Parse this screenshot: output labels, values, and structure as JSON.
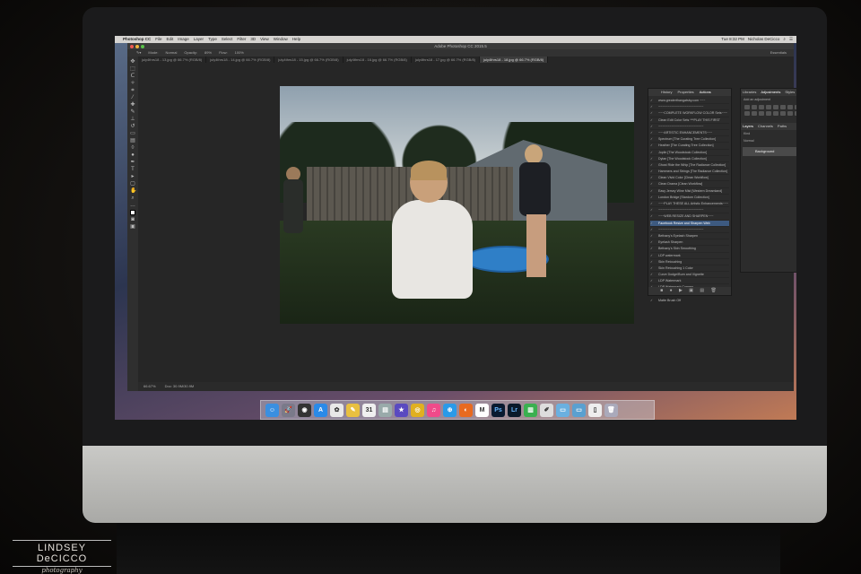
{
  "menubar": {
    "app_name": "Photoshop CC",
    "menus": [
      "File",
      "Edit",
      "Image",
      "Layer",
      "Type",
      "Select",
      "Filter",
      "3D",
      "View",
      "Window",
      "Help"
    ],
    "clock": "Tue 8:32 PM",
    "user": "Nicholas DeCicco"
  },
  "photoshop": {
    "window_title": "Adobe Photoshop CC 2015.5",
    "options": {
      "mode_label": "Mode:",
      "mode_value": "Normal",
      "opacity_label": "Opacity:",
      "opacity_value": "89%",
      "flow_label": "Flow:",
      "flow_value": "100%",
      "workspace": "Essentials"
    },
    "tabs": [
      {
        "label": "july4thrs18 - 13.jpg @ 66.7% (RGB/8)",
        "active": false
      },
      {
        "label": "july4thrs18 - 14.jpg @ 66.7% (RGB/8)",
        "active": false
      },
      {
        "label": "july4thrs18 - 15.jpg @ 66.7% (RGB/8)",
        "active": false
      },
      {
        "label": "july4thrs18 - 16.jpg @ 66.7% (RGB/8)",
        "active": false
      },
      {
        "label": "july4thrs18 - 17.jpg @ 66.7% (RGB/8)",
        "active": false
      },
      {
        "label": "july4thrs18 - 18.jpg @ 66.7% (RGB/8)",
        "active": true
      }
    ],
    "status": {
      "zoom": "66.67%",
      "doc": "Doc: 30.9M/30.9M"
    },
    "actions_panel": {
      "tabs": [
        "History",
        "Properties",
        "Actions"
      ],
      "rows": [
        {
          "label": "www.greaterthangatsby.com ~~~",
          "hl": false
        },
        {
          "label": "~~~~~~~~~~~~~~~~~~~~~~~~",
          "hl": false
        },
        {
          "label": "~~~COMPLETE WORKFLOW COLOR Sets~~~",
          "hl": false
        },
        {
          "label": "Clean Edit Color Sets ***PLAY THIS FIRST",
          "hl": false
        },
        {
          "label": "~~~~~~~~~~~~~~~~~~~~~~~~",
          "hl": false
        },
        {
          "label": "~~~ARTISTIC ENHANCEMENTS~~~",
          "hl": false
        },
        {
          "label": "Spectrum  [The Curating Tree Collection]",
          "hl": false
        },
        {
          "label": "Heather  [The Curating Tree Collection]",
          "hl": false
        },
        {
          "label": "Joplin  [The Woodstock Collection]",
          "hl": false
        },
        {
          "label": "Dylan  [The Woodstock Collection]",
          "hl": false
        },
        {
          "label": "Ghost Ride the Whip  [The Radiance Collection]",
          "hl": false
        },
        {
          "label": "Hammers and Strings  [The Radiance Collection]",
          "hl": false
        },
        {
          "label": "Clean Vivid Color  [Clean Workflow]",
          "hl": false
        },
        {
          "label": "Clean Drama  [Clean Workflow]",
          "hl": false
        },
        {
          "label": "Easy Jersey Wine Mist  [Western Dreamland]",
          "hl": false
        },
        {
          "label": "London Bridge  [Stardom Collection]",
          "hl": false
        },
        {
          "label": "~~~PLAY THESE ALL Artistic Enhancements~~~",
          "hl": false
        },
        {
          "label": "~~~~~~~~~~~~~~~~~~~~~~~~",
          "hl": false
        },
        {
          "label": "~~~WEB RESIZE AND SHARPEN~~~",
          "hl": false
        },
        {
          "label": "Facebook Resize and Sharpen Web",
          "hl": true
        },
        {
          "label": "~~~~~~~~~~~~~~~~~~~~~~~~",
          "hl": false
        },
        {
          "label": "Bethany's Eyelash Sharpen",
          "hl": false
        },
        {
          "label": "Eyelash Sharpen",
          "hl": false
        },
        {
          "label": "Bethany's Skin Smoothing",
          "hl": false
        },
        {
          "label": "LDP watermark",
          "hl": false
        },
        {
          "label": "Skin Retouching",
          "hl": false
        },
        {
          "label": "Skin Retouching 1 Color",
          "hl": false
        },
        {
          "label": "Curve Dodge/Burn and Vignette",
          "hl": false
        },
        {
          "label": "LDP Watermark",
          "hl": false
        },
        {
          "label": "LDP Watermark Corners",
          "hl": false
        },
        {
          "label": "Dust It Down",
          "hl": false
        },
        {
          "label": "Matte Brush Off",
          "hl": false
        }
      ],
      "footer_icons": "■ ● ▶ ▣ ▤ 🗑"
    },
    "right_panel": {
      "top_tabs": [
        "Libraries",
        "Adjustments",
        "Styles"
      ],
      "add_adjustment": "Add an adjustment",
      "layer_tabs": [
        "Layers",
        "Channels",
        "Paths"
      ],
      "kind_label": "Kind",
      "blend_mode": "Normal",
      "layer_name": "Background"
    }
  },
  "dock": {
    "apps": [
      {
        "name": "finder-icon",
        "glyph": "☺",
        "color": "#3a8fe0"
      },
      {
        "name": "launchpad-icon",
        "glyph": "🚀",
        "color": "#7a7a8a"
      },
      {
        "name": "dashboard-icon",
        "glyph": "◉",
        "color": "#333"
      },
      {
        "name": "app-store-icon",
        "glyph": "A",
        "color": "#2a8ae8"
      },
      {
        "name": "photos-icon",
        "glyph": "✿",
        "color": "#e8e8e8"
      },
      {
        "name": "notes-icon",
        "glyph": "✎",
        "color": "#e8c040"
      },
      {
        "name": "calendar-icon",
        "glyph": "31",
        "color": "#f0f0f0"
      },
      {
        "name": "preview-icon",
        "glyph": "▤",
        "color": "#9aa"
      },
      {
        "name": "imovie-icon",
        "glyph": "★",
        "color": "#5a4ac0"
      },
      {
        "name": "chrome-icon",
        "glyph": "◎",
        "color": "#e0b020"
      },
      {
        "name": "itunes-icon",
        "glyph": "♫",
        "color": "#f04a8a"
      },
      {
        "name": "safari-icon",
        "glyph": "⊕",
        "color": "#2a9ae8"
      },
      {
        "name": "firefox-icon",
        "glyph": "◐",
        "color": "#e86a20"
      },
      {
        "name": "mail-icon",
        "glyph": "M",
        "color": "#fff"
      },
      {
        "name": "photoshop-icon",
        "glyph": "Ps",
        "color": "#0a1a30"
      },
      {
        "name": "lightroom-icon",
        "glyph": "Lr",
        "color": "#0a1a2a"
      },
      {
        "name": "numbers-icon",
        "glyph": "▥",
        "color": "#3ab050"
      },
      {
        "name": "textedit-icon",
        "glyph": "✐",
        "color": "#ddd"
      },
      {
        "name": "folder-icon",
        "glyph": "▭",
        "color": "#6ab0e0"
      },
      {
        "name": "downloads-icon",
        "glyph": "▭",
        "color": "#5aa0d0"
      },
      {
        "name": "document-icon",
        "glyph": "▯",
        "color": "#eee"
      },
      {
        "name": "trash-icon",
        "glyph": "🗑",
        "color": "#aab"
      }
    ]
  },
  "watermark": {
    "name": "LINDSEY DeCICCO",
    "tagline": "photography"
  }
}
